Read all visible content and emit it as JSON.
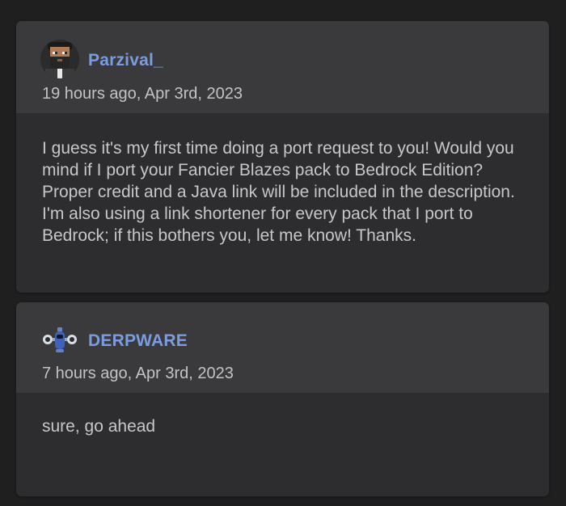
{
  "comments": [
    {
      "username": "Parzival_",
      "timestamp": "19 hours ago, Apr 3rd, 2023",
      "text": "I guess it's my first time doing a port request to you! Would you mind if I port your Fancier Blazes pack to Bedrock Edition? Proper credit and a Java link will be included in the description. I'm also using a link shortener for every pack that I port to Bedrock; if this bothers you, let me know! Thanks.",
      "avatar_icon": "pixel-bearded-man-avatar-icon"
    },
    {
      "username": "DERPWARE",
      "timestamp": "7 hours ago, Apr 3rd, 2023",
      "text": "sure, go ahead",
      "avatar_icon": "blue-robot-avatar-icon"
    }
  ],
  "colors": {
    "page_background": "#1f1f20",
    "card_header": "#3a3a3c",
    "card_body": "#2d2d2f",
    "username": "#7b9cde",
    "text": "#c7c7c9"
  }
}
